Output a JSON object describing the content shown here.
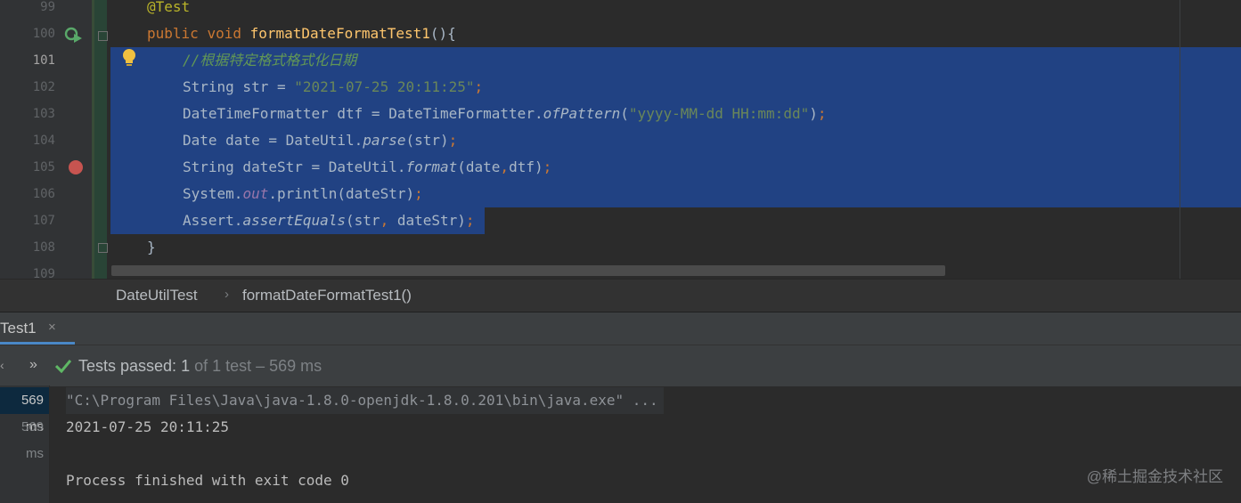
{
  "editor": {
    "line_numbers": [
      "99",
      "100",
      "101",
      "102",
      "103",
      "104",
      "105",
      "106",
      "107",
      "108",
      "109"
    ],
    "lines": {
      "l99": {
        "annotation": "@Test"
      },
      "l100": {
        "kw1": "public",
        "kw2": "void",
        "method": "formatDateFormatTest1",
        "rest": "(){"
      },
      "l101": {
        "comment": "//根据特定格式格式化日期"
      },
      "l102": {
        "a": "String str = ",
        "str": "\"2021-07-25 20:11:25\"",
        "end": ";"
      },
      "l103": {
        "a": "DateTimeFormatter dtf = DateTimeFormatter.",
        "call": "ofPattern",
        "p1": "(",
        "str": "\"yyyy-MM-dd HH:mm:dd\"",
        "p2": ")",
        "end": ";"
      },
      "l104": {
        "a": "Date date = DateUtil.",
        "call": "parse",
        "b": "(str)",
        "end": ";"
      },
      "l105": {
        "a": "String dateStr = DateUtil.",
        "call": "format",
        "b": "(date",
        "comma": ",",
        "c": "dtf)",
        "end": ";"
      },
      "l106": {
        "a": "System.",
        "field": "out",
        "b": ".println(dateStr)",
        "end": ";"
      },
      "l107": {
        "a": "Assert.",
        "call": "assertEquals",
        "b": "(str",
        "comma": ",",
        "c": " dateStr)",
        "end": ";"
      },
      "l108": {
        "brace": "}"
      }
    },
    "current_line": "101",
    "breakpoint_line": "105"
  },
  "breadcrumb": {
    "class_name": "DateUtilTest",
    "separator": "›",
    "method_name": "formatDateFormatTest1()"
  },
  "run_panel": {
    "tab_label": "Test1",
    "tab_close": "×",
    "toolbar_left": "‹",
    "toolbar_more": "»",
    "status_passed": "Tests passed: ",
    "status_count": "1",
    "status_rest": " of 1 test – 569 ms",
    "tree_rows": [
      "569 ms",
      "569 ms"
    ],
    "console": {
      "command": "\"C:\\Program Files\\Java\\java-1.8.0-openjdk-1.8.0.201\\bin\\java.exe\" ...",
      "output": "2021-07-25 20:11:25",
      "blank": "",
      "exit": "Process finished with exit code 0"
    }
  },
  "watermark": "@稀土掘金技术社区",
  "colors": {
    "selection": "#214283",
    "keyword": "#cc7832",
    "string": "#6a8759",
    "method": "#ffc66d",
    "pass_green": "#5fb865",
    "breakpoint": "#c75450"
  }
}
